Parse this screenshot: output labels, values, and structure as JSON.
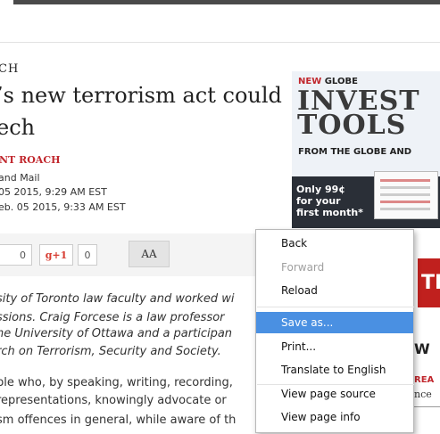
{
  "article": {
    "section_label": "CH",
    "headline_line1": "’s new terrorism act could",
    "headline_line2": "ech",
    "author": "NT ROACH",
    "source": "and Mail",
    "published": "05 2015, 9:29 AM EST",
    "updated": "eb. 05 2015, 9:33 AM EST",
    "body_italic": [
      "sity of Toronto law faculty and worked wi",
      "ssions. Craig Forcese is a law professor",
      "he University of Ottawa and a participan",
      "rch on Terrorism, Security and Society."
    ],
    "body_plain": [
      "ple who, by speaking, writing, recording,",
      " representations, knowingly advocate or",
      "sm offences in general, while aware of th"
    ]
  },
  "share": {
    "count_label": "0",
    "gplus_label": "g+1",
    "gplus_count": "0",
    "text_size_label": "AA"
  },
  "ad": {
    "new_label": "NEW",
    "globe_label": "GLOBE",
    "headline_1": "INVEST",
    "headline_2": "TOOLS",
    "from_label": "FROM THE GLOBE AND",
    "offer_1": "Only 99¢",
    "offer_2": "for your",
    "offer_3": "first month*",
    "side_label": "TR",
    "side_w": "W",
    "side_rea": "REA",
    "side_nce": "nce"
  },
  "context_menu": {
    "items": [
      {
        "label": "Back",
        "state": "normal"
      },
      {
        "label": "Forward",
        "state": "disabled"
      },
      {
        "label": "Reload",
        "state": "normal"
      },
      {
        "label": "Save as...",
        "state": "active"
      },
      {
        "label": "Print...",
        "state": "normal"
      },
      {
        "label": "Translate to English",
        "state": "normal"
      },
      {
        "label": "View page source",
        "state": "normal"
      },
      {
        "label": "View page info",
        "state": "normal"
      }
    ]
  },
  "colors": {
    "accent_red": "#c1272d",
    "menu_highlight": "#4a90e2"
  }
}
